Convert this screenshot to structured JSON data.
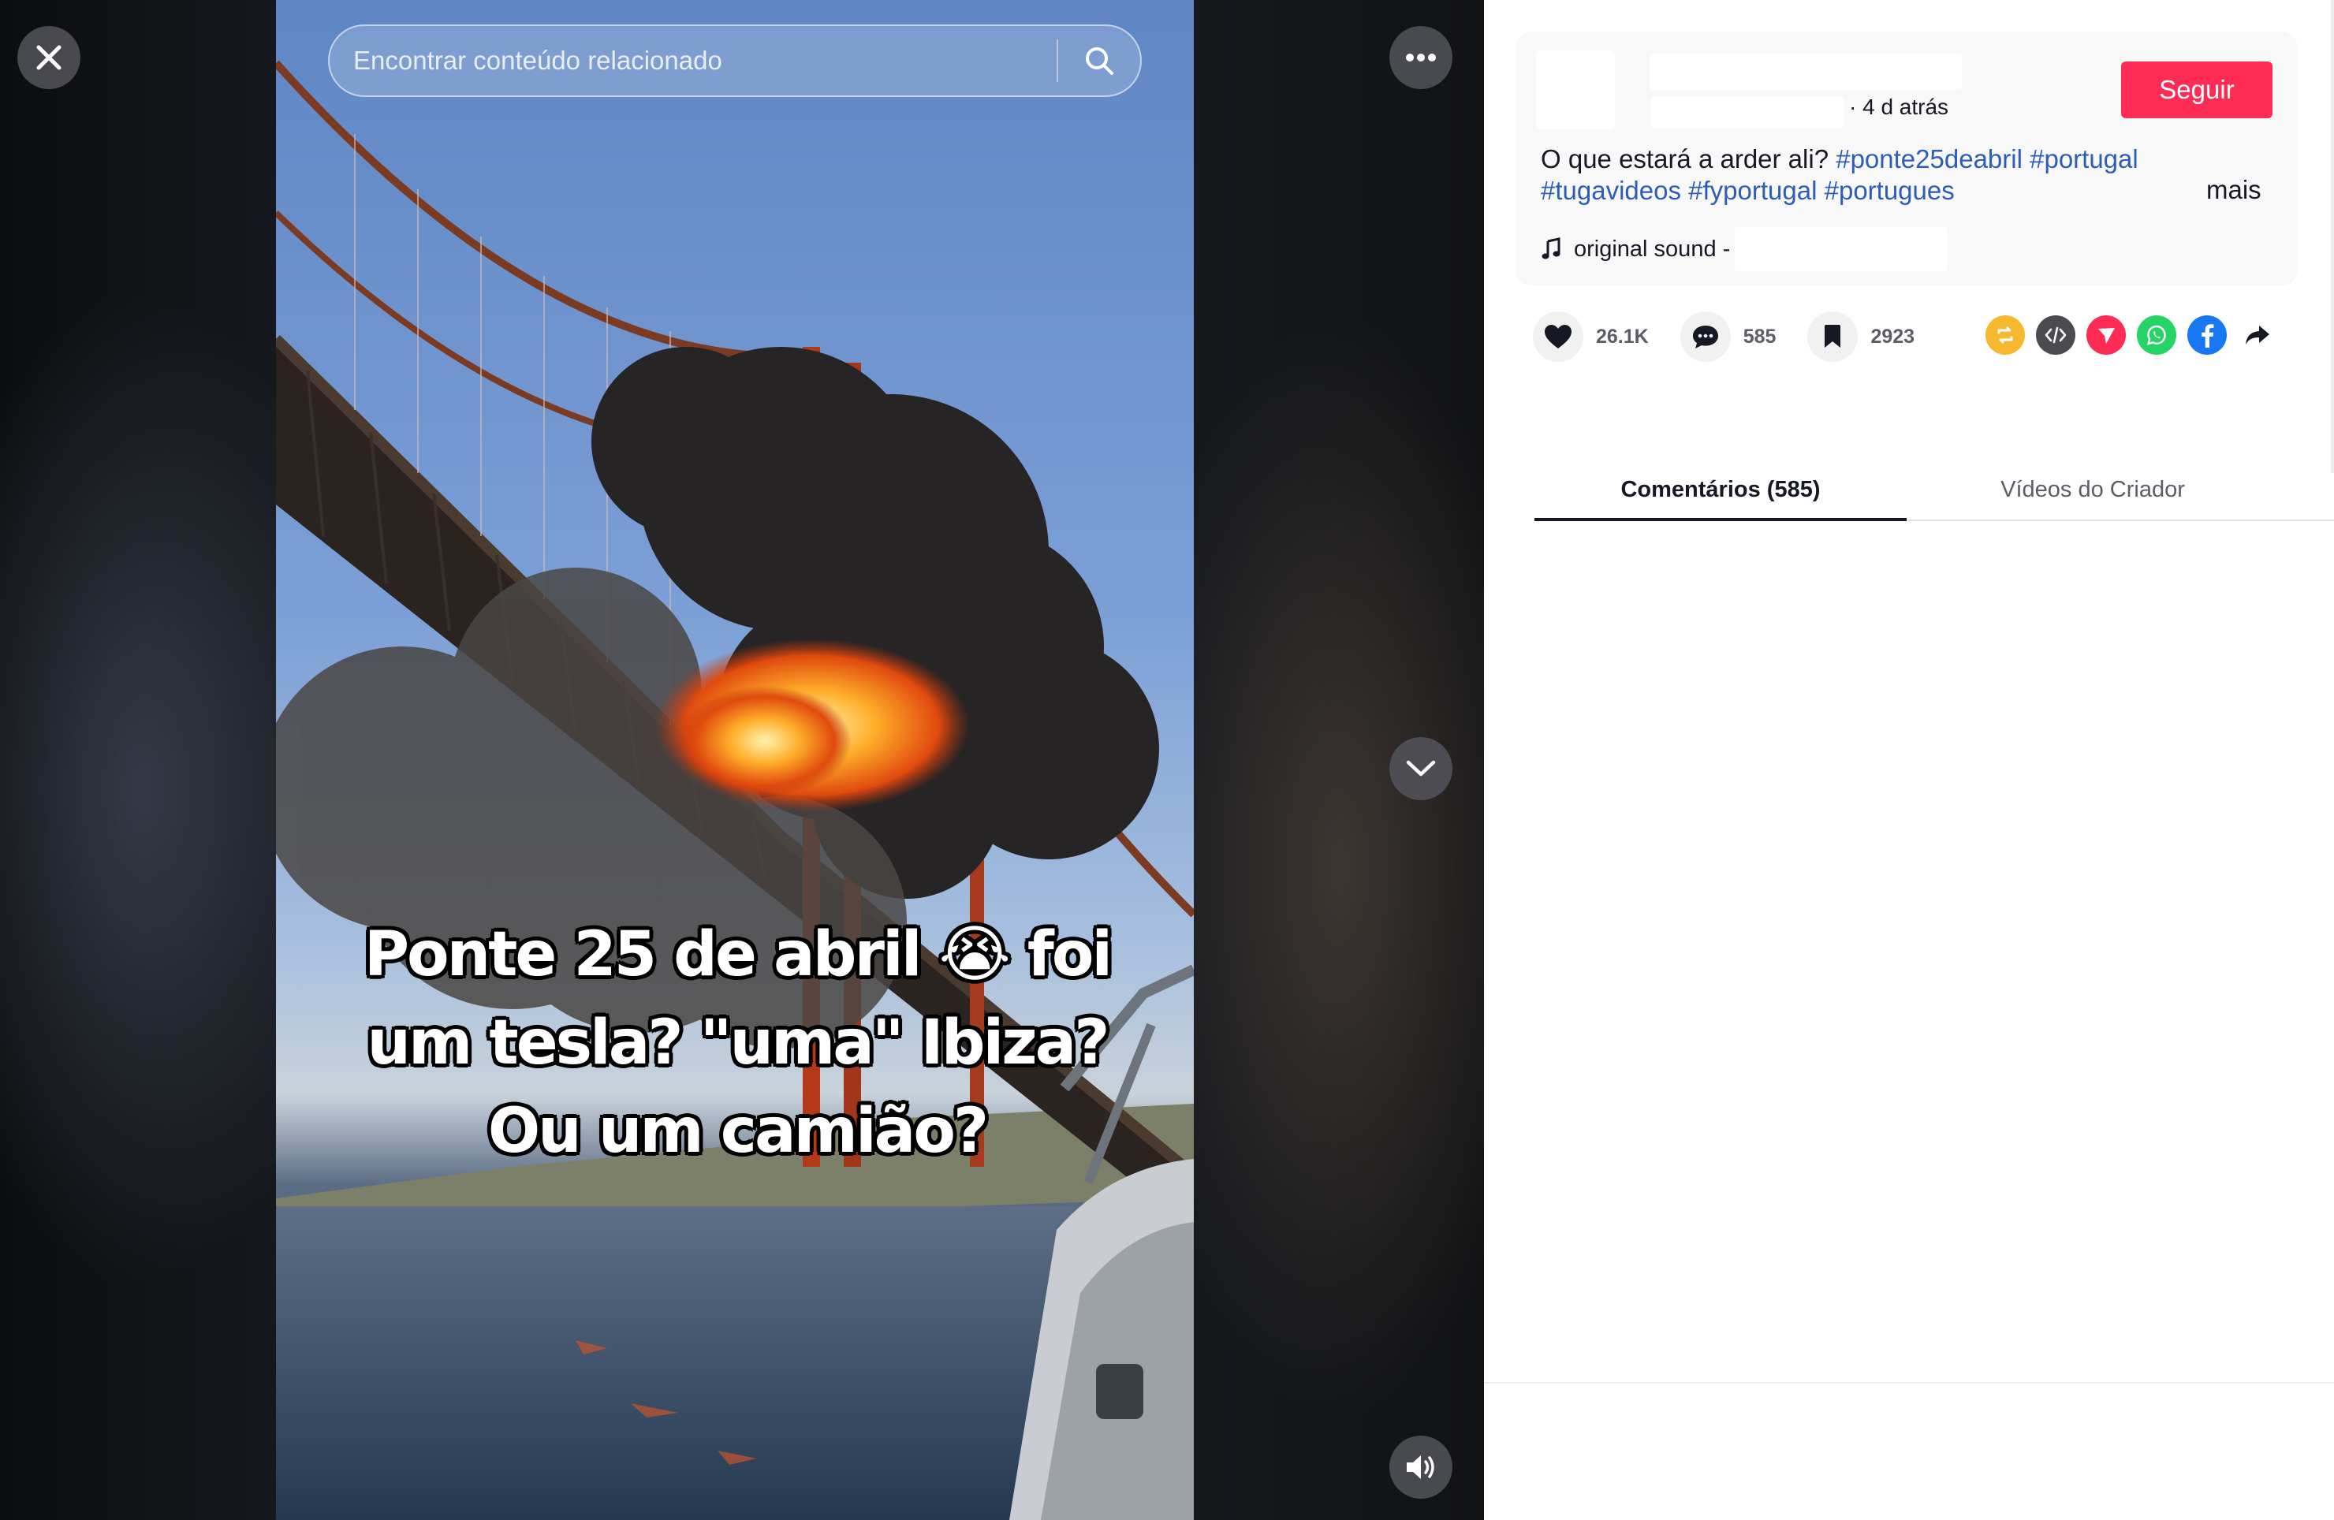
{
  "search": {
    "placeholder": "Encontrar conteúdo relacionado"
  },
  "video": {
    "caption_lines": [
      "Ponte 25 de abril 😭 foi",
      "um tesla? \"uma\" Ibiza?",
      "Ou um camião?"
    ]
  },
  "post": {
    "time": "· 4 d atrás",
    "follow_label": "Seguir",
    "description_text": "O que estará a arder ali?",
    "hashtags": [
      "#ponte25deabril",
      "#portugal",
      "#tugavideos",
      "#fyportugal",
      "#portugues"
    ],
    "more_label": "mais",
    "sound_label": "original sound -"
  },
  "stats": {
    "likes": "26.1K",
    "comments": "585",
    "saves": "2923"
  },
  "share_icons": [
    {
      "name": "repost-icon",
      "color": "#f5b82e"
    },
    {
      "name": "embed-icon",
      "color": "#4b4b4f"
    },
    {
      "name": "send-icon",
      "color": "#fe2c55"
    },
    {
      "name": "whatsapp-icon",
      "color": "#25d366"
    },
    {
      "name": "facebook-icon",
      "color": "#1877f2"
    },
    {
      "name": "share-arrow-icon",
      "color": "#161823"
    }
  ],
  "tabs": [
    {
      "label": "Comentários (585)",
      "active": true
    },
    {
      "label": "Vídeos do Criador",
      "active": false
    }
  ],
  "colors": {
    "accent": "#fe2c55",
    "hashtag": "#2b5db9",
    "text": "#161823",
    "muted": "#5c5d66"
  }
}
